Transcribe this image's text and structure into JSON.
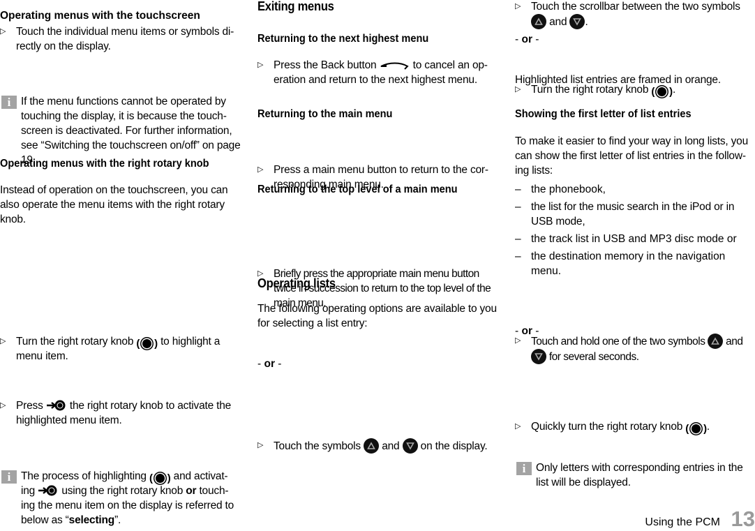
{
  "col1": {
    "h_touch": "Operating menus with the touchscreen",
    "touch_step": "Touch the individual menu items or symbols di-rectly on the display.",
    "touch_note": "If the menu functions cannot be operated by touching the display, it is because the touch-screen is deactivated. For further information, see “Switching the touchscreen on/off” on page 19.",
    "h_knob": "Operating menus with the right rotary knob",
    "knob_intro": "Instead of operation on the touchscreen, you can also operate the menu items with the right rotary knob.",
    "knob_step1_a": "Turn the right rotary knob",
    "knob_step1_b": "to highlight a menu item.",
    "knob_step2_a": "Press",
    "knob_step2_b": "the right rotary knob to activate the highlighted menu item.",
    "note2_a": "The process of highlighting",
    "note2_b": "and activat-ing",
    "note2_c": "using the right rotary knob",
    "note2_or": "or",
    "note2_d": "touch-ing the menu item on the display is referred to below as “",
    "note2_sel": "selecting",
    "note2_e": "”."
  },
  "col2": {
    "h_exit": "Exiting menus",
    "h_next": "Returning to the next highest menu",
    "next_a": "Press the Back button",
    "next_b": "to cancel an op-eration and return to the next highest menu.",
    "h_main": "Returning to the main menu",
    "main_step": "Press a main menu button to return to the cor-responding main menu.",
    "h_top": "Returning to the top level of a main menu",
    "top_step": "Briefly press the appropriate main menu button twice in succession to return to the top level of the main menu.",
    "h_lists": "Operating lists",
    "lists_intro": "The following operating options are available to you for selecting a list entry:",
    "lists_step_a": "Touch the symbols",
    "lists_step_and": "and",
    "lists_step_b": "on the display.",
    "or_label": "or"
  },
  "col3": {
    "scroll_a": "Touch the scrollbar between the two symbols",
    "scroll_and": "and",
    "scroll_end": ".",
    "or_label": "or",
    "turn_step": "Turn the right rotary knob",
    "turn_end": ".",
    "highlighted": "Highlighted list entries are framed in orange.",
    "h_first": "Showing the first letter of list entries",
    "first_intro": "To make it easier to find your way in long lists, you can show the first letter of list entries in the follow-ing lists:",
    "list_items": [
      "the phonebook,",
      "the list for the music search in the iPod or in USB mode,",
      "the track list in USB and MP3 disc mode or",
      "the destination memory in the navigation menu."
    ],
    "hold_a": "Touch and hold one of the two symbols",
    "hold_and": "and",
    "hold_b": "for several seconds.",
    "quick_step": "Quickly turn the right rotary knob",
    "quick_end": ".",
    "note": "Only letters with corresponding entries in the list will be displayed."
  },
  "footer": {
    "section_title": "Using the PCM",
    "page_number": "13"
  },
  "icons": {
    "step_marker": "▷",
    "dash_marker": "–",
    "info": "i",
    "dash_or": "-"
  },
  "colors": {
    "info_box": "#a3a3a3",
    "page_number": "#9a9a9a"
  }
}
